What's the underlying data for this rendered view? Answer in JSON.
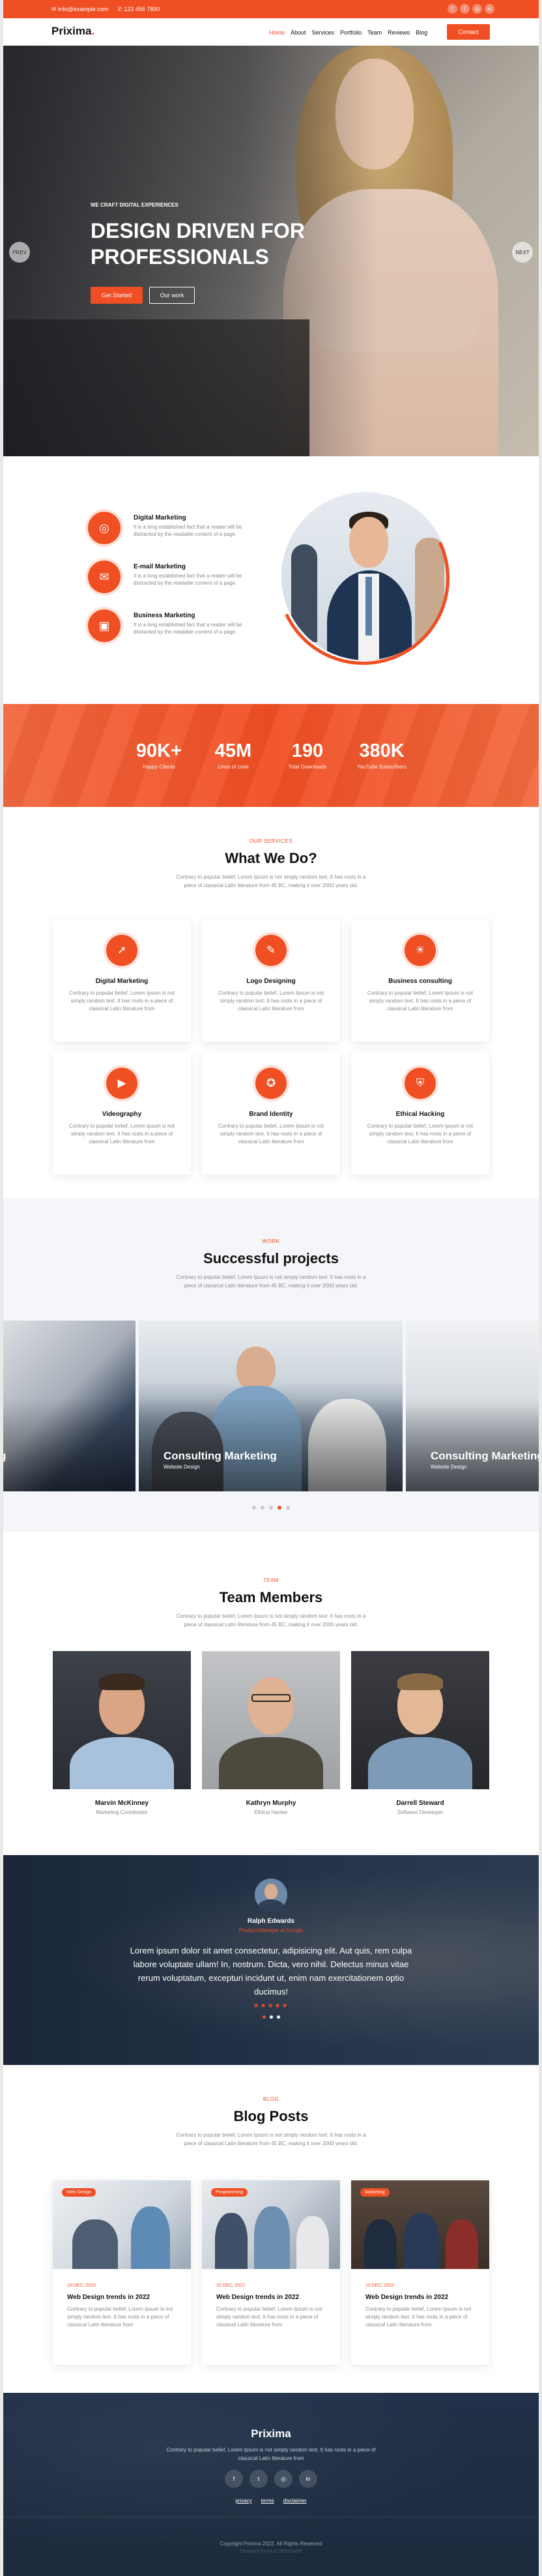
{
  "topbar": {
    "email": "info@example.com",
    "phone": "123 456 7890",
    "social_icons": [
      "facebook-icon",
      "twitter-icon",
      "instagram-icon",
      "linkedin-icon"
    ]
  },
  "header": {
    "logo": "Prixima",
    "logo_dot": ".",
    "nav": [
      "Home",
      "About",
      "Services",
      "Portfolio",
      "Team",
      "Reviews",
      "Blog"
    ],
    "active_nav": "Home",
    "contact_button": "Contact"
  },
  "hero": {
    "eyebrow": "WE CRAFT DIGITAL EXPERIENCES",
    "title": "DESIGN DRIVEN FOR PROFESSIONALS",
    "primary_button": "Get Started",
    "secondary_button": "Our work",
    "prev_label": "PREV",
    "next_label": "NEXT"
  },
  "features": [
    {
      "title": "Digital Marketing",
      "desc": "It is a long established fact that a reader will be distracted by the readable content of a page.",
      "icon": "target-icon"
    },
    {
      "title": "E-mail Marketing",
      "desc": "It is a long established fact that a reader will be distracted by the readable content of a page.",
      "icon": "email-icon"
    },
    {
      "title": "Business Marketing",
      "desc": "It is a long established fact that a reader will be distracted by the readable content of a page.",
      "icon": "briefcase-icon"
    }
  ],
  "stats": [
    {
      "value": "90K+",
      "label": "Happy Clients"
    },
    {
      "value": "45M",
      "label": "Lines of code"
    },
    {
      "value": "190",
      "label": "Total Downloads"
    },
    {
      "value": "380K",
      "label": "YouTube Subscribers"
    }
  ],
  "services": {
    "eyebrow": "OUR SERVICES",
    "title": "What We Do?",
    "lead": "Contrary to popular belief, Lorem Ipsum is not simply random text. It has roots in a piece of classical Latin literature from 45 BC, making it over 2000 years old.",
    "items": [
      {
        "title": "Digital Marketing",
        "desc": "Contrary to popular belief, Lorem Ipsum is not simply random text. It has roots in a piece of classical Latin literature from",
        "icon": "rocket-icon"
      },
      {
        "title": "Logo Designing",
        "desc": "Contrary to popular belief, Lorem Ipsum is not simply random text. It has roots in a piece of classical Latin literature from",
        "icon": "pen-tool-icon"
      },
      {
        "title": "Business consulting",
        "desc": "Contrary to popular belief, Lorem Ipsum is not simply random text. It has roots in a piece of classical Latin literature from",
        "icon": "lightbulb-icon"
      },
      {
        "title": "Videography",
        "desc": "Contrary to popular belief, Lorem Ipsum is not simply random text. It has roots in a piece of classical Latin literature from",
        "icon": "video-icon"
      },
      {
        "title": "Brand Identity",
        "desc": "Contrary to popular belief, Lorem Ipsum is not simply random text. It has roots in a piece of classical Latin literature from",
        "icon": "badge-icon"
      },
      {
        "title": "Ethical Hacking",
        "desc": "Contrary to popular belief, Lorem Ipsum is not simply random text. It has roots in a piece of classical Latin literature from",
        "icon": "shield-icon"
      }
    ]
  },
  "projects": {
    "eyebrow": "WORK",
    "title": "Successful projects",
    "lead": "Contrary to popular belief, Lorem Ipsum is not simply random text. It has roots in a piece of classical Latin literature from 45 BC, making it over 2000 years old.",
    "items": [
      {
        "title": "g",
        "subtitle": ""
      },
      {
        "title": "Consulting Marketing",
        "subtitle": "Website Design"
      },
      {
        "title": "Consulting Marketing",
        "subtitle": "Website Design"
      }
    ],
    "dots": 5,
    "active_dot": 3
  },
  "team": {
    "eyebrow": "TEAM",
    "title": "Team Members",
    "lead": "Contrary to popular belief, Lorem Ipsum is not simply random text. It has roots in a piece of classical Latin literature from 45 BC, making it over 2000 years old.",
    "members": [
      {
        "name": "Marvin McKinney",
        "role": "Marketing Coordinator"
      },
      {
        "name": "Kathryn Murphy",
        "role": "Ethical Hacker"
      },
      {
        "name": "Darrell Steward",
        "role": "Software Developer"
      }
    ]
  },
  "testimonial": {
    "name": "Ralph Edwards",
    "role": "Product Manager at Google",
    "quote": "Lorem ipsum dolor sit amet consectetur, adipisicing elit. Aut quis, rem culpa labore voluptate ullam! In, nostrum. Dicta, vero nihil. Delectus minus vitae rerum voluptatum, excepturi incidunt ut, enim nam exercitationem optio ducimus!",
    "stars": "★★★★★",
    "dots": 3,
    "active_dot": 0
  },
  "blog": {
    "eyebrow": "BLOG",
    "title": "Blog Posts",
    "lead": "Contrary to popular belief, Lorem Ipsum is not simply random text. It has roots in a piece of classical Latin literature from 45 BC, making it over 2000 years old.",
    "posts": [
      {
        "tag": "Web Design",
        "date": "10 DEC, 2022",
        "title": "Web Design trends in 2022",
        "desc": "Contrary to popular belief, Lorem Ipsum is not simply random text. It has roots in a piece of classical Latin literature from"
      },
      {
        "tag": "Programming",
        "date": "10 DEC, 2022",
        "title": "Web Design trends in 2022",
        "desc": "Contrary to popular belief, Lorem Ipsum is not simply random text. It has roots in a piece of classical Latin literature from"
      },
      {
        "tag": "Marketing",
        "date": "10 DEC, 2022",
        "title": "Web Design trends in 2022",
        "desc": "Contrary to popular belief, Lorem Ipsum is not simply random text. It has roots in a piece of classical Latin literature from"
      }
    ]
  },
  "footer": {
    "logo": "Prixima",
    "desc": "Contrary to popular belief, Lorem Ipsum is not simply random text. It has roots in a piece of classical Latin literature from",
    "social": [
      "f",
      "t",
      "◎",
      "in"
    ],
    "social_icons": [
      "facebook-icon",
      "twitter-icon",
      "instagram-icon",
      "linkedin-icon"
    ],
    "links": [
      "privacy",
      "terms",
      "disclaimer"
    ],
    "copyright": "Copyright Prixima 2022. All Rights Reserved",
    "designed_by": "Designed by KILD DESIGNER"
  },
  "colors": {
    "accent": "#f04e23",
    "dark": "#1e2d42"
  }
}
